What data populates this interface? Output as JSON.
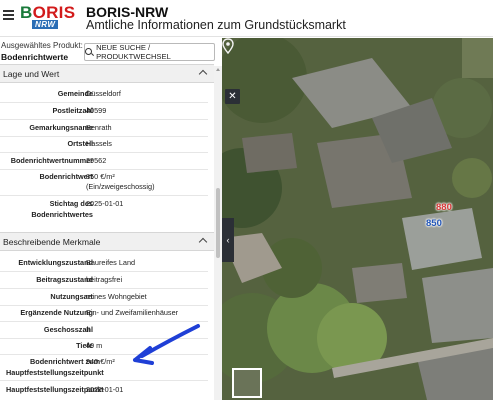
{
  "header": {
    "logo_main": "BORIS",
    "logo_sub": "NRW",
    "title": "BORIS-NRW",
    "subtitle": "Amtliche Informationen zum Grundstücksmarkt"
  },
  "product": {
    "label": "Ausgewähltes Produkt:",
    "value": "Bodenrichtwerte",
    "new_search": "NEUE SUCHE / PRODUKTWECHSEL"
  },
  "sections": {
    "lage": {
      "title": "Lage und Wert",
      "rows": [
        {
          "key": "Gemeinde",
          "value": "Düsseldorf"
        },
        {
          "key": "Postleitzahl",
          "value": "40599"
        },
        {
          "key": "Gemarkungsname",
          "value": "Benrath"
        },
        {
          "key": "Ortsteil",
          "value": "Hassels"
        },
        {
          "key": "Bodenrichtwertnummer",
          "value": "29562"
        },
        {
          "key": "Bodenrichtwert",
          "value": "850 €/m²",
          "value2": "(Ein/zweigeschossig)"
        },
        {
          "key": "Stichtag des",
          "key2": "Bodenrichtwertes",
          "value": "2025-01-01"
        }
      ]
    },
    "merkmale": {
      "title": "Beschreibende Merkmale",
      "rows": [
        {
          "key": "Entwicklungszustand",
          "value": "Baureifes Land"
        },
        {
          "key": "Beitragszustand",
          "value": "beitragsfrei"
        },
        {
          "key": "Nutzungsart",
          "value": "reines Wohngebiet"
        },
        {
          "key": "Ergänzende Nutzung",
          "value": "Ein- und Zweifamilienhäuser"
        },
        {
          "key": "Geschosszahl",
          "value": "II"
        },
        {
          "key": "Tiefe",
          "value": "40 m"
        },
        {
          "key": "Bodenrichtwert zum",
          "key2": "Hauptfeststellungszeitpunkt",
          "value": "940 €/m²"
        },
        {
          "key": "Hauptfeststellungszeitpunkt",
          "value": "2022-01-01"
        }
      ]
    }
  },
  "map": {
    "label_red": "880",
    "label_blue": "850",
    "close_icon": "close-icon",
    "collapse_icon": "chevron-left-icon"
  },
  "colors": {
    "accent_red": "#d93a3a",
    "accent_blue": "#2357b9",
    "arrow_blue": "#1f3fd6",
    "map_controls": "#2b2f36"
  }
}
